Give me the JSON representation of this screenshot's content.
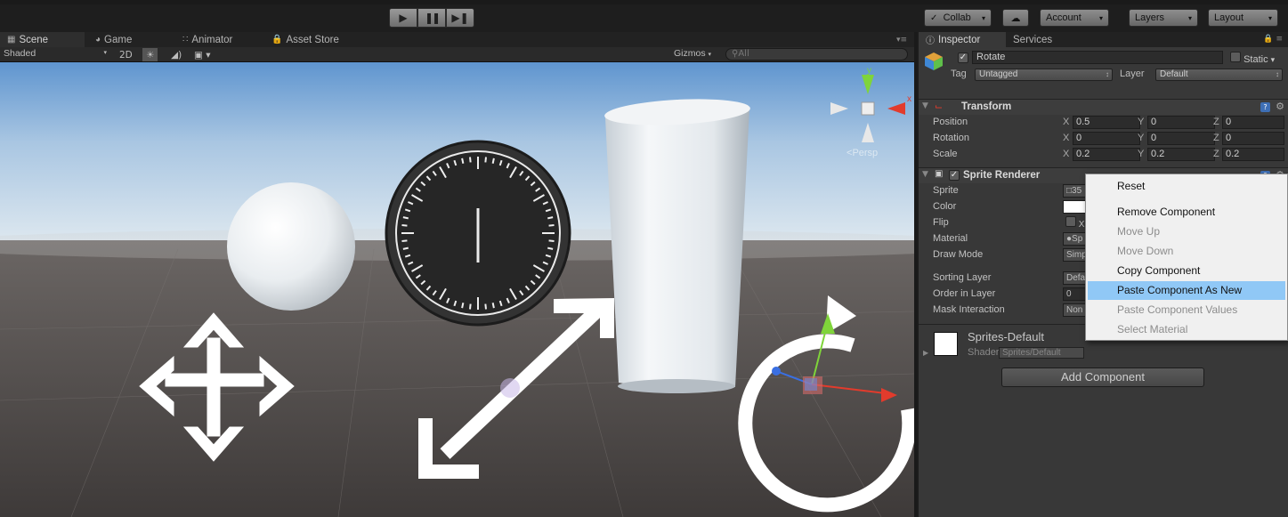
{
  "toolbar": {
    "play_icon": "play-icon",
    "pause_icon": "pause-icon",
    "step_icon": "step-icon",
    "collab_label": "Collab",
    "cloud_icon": "cloud-icon",
    "account_label": "Account",
    "layers_label": "Layers",
    "layout_label": "Layout"
  },
  "scene": {
    "tabs": [
      {
        "label": "Scene",
        "icon": "grid-icon"
      },
      {
        "label": "Game",
        "icon": "pacman-icon"
      },
      {
        "label": "Animator",
        "icon": "animator-icon"
      },
      {
        "label": "Asset Store",
        "icon": "lock-icon"
      }
    ],
    "shading_mode": "Shaded",
    "mode_2d": "2D",
    "gizmos_label": "Gizmos",
    "search_placeholder": "All",
    "persp_label": "Persp",
    "orientation_axes": {
      "x": "x",
      "y": "y",
      "z": "z"
    }
  },
  "inspector": {
    "tabs": [
      {
        "label": "Inspector"
      },
      {
        "label": "Services"
      }
    ],
    "gameobject": {
      "name": "Rotate",
      "active": true,
      "static_label": "Static",
      "tag_label": "Tag",
      "tag_value": "Untagged",
      "layer_label": "Layer",
      "layer_value": "Default"
    },
    "transform": {
      "title": "Transform",
      "rows": [
        {
          "label": "Position",
          "x": "0.5",
          "y": "0",
          "z": "0"
        },
        {
          "label": "Rotation",
          "x": "0",
          "y": "0",
          "z": "0"
        },
        {
          "label": "Scale",
          "x": "0.2",
          "y": "0.2",
          "z": "0.2"
        }
      ],
      "axis_labels": {
        "x": "X",
        "y": "Y",
        "z": "Z"
      }
    },
    "sprite_renderer": {
      "title": "Sprite Renderer",
      "props": [
        {
          "label": "Sprite",
          "value": "35"
        },
        {
          "label": "Color",
          "value": ""
        },
        {
          "label": "Flip",
          "value": "X"
        },
        {
          "label": "Material",
          "value": "Sp"
        },
        {
          "label": "Draw Mode",
          "value": "Simp"
        },
        {
          "label": "Sorting Layer",
          "value": "Defa"
        },
        {
          "label": "Order in Layer",
          "value": "0"
        },
        {
          "label": "Mask Interaction",
          "value": "Non"
        }
      ]
    },
    "material": {
      "name": "Sprites-Default",
      "shader_label": "Shader",
      "shader_value": "Sprites/Default"
    },
    "add_component_label": "Add Component"
  },
  "context_menu": {
    "items": [
      {
        "label": "Reset",
        "enabled": true
      },
      {
        "label": "Remove Component",
        "enabled": true
      },
      {
        "label": "Move Up",
        "enabled": false
      },
      {
        "label": "Move Down",
        "enabled": false
      },
      {
        "label": "Copy Component",
        "enabled": true
      },
      {
        "label": "Paste Component As New",
        "enabled": true,
        "highlighted": true
      },
      {
        "label": "Paste Component Values",
        "enabled": false
      },
      {
        "label": "Select Material",
        "enabled": false
      }
    ]
  },
  "colors": {
    "highlight": "#90c8f6",
    "sky": "#6e9fd0",
    "ground": "#4a4745",
    "axis_x": "#e23b2c",
    "axis_y": "#7fd43a",
    "axis_z": "#3a6fe2"
  }
}
